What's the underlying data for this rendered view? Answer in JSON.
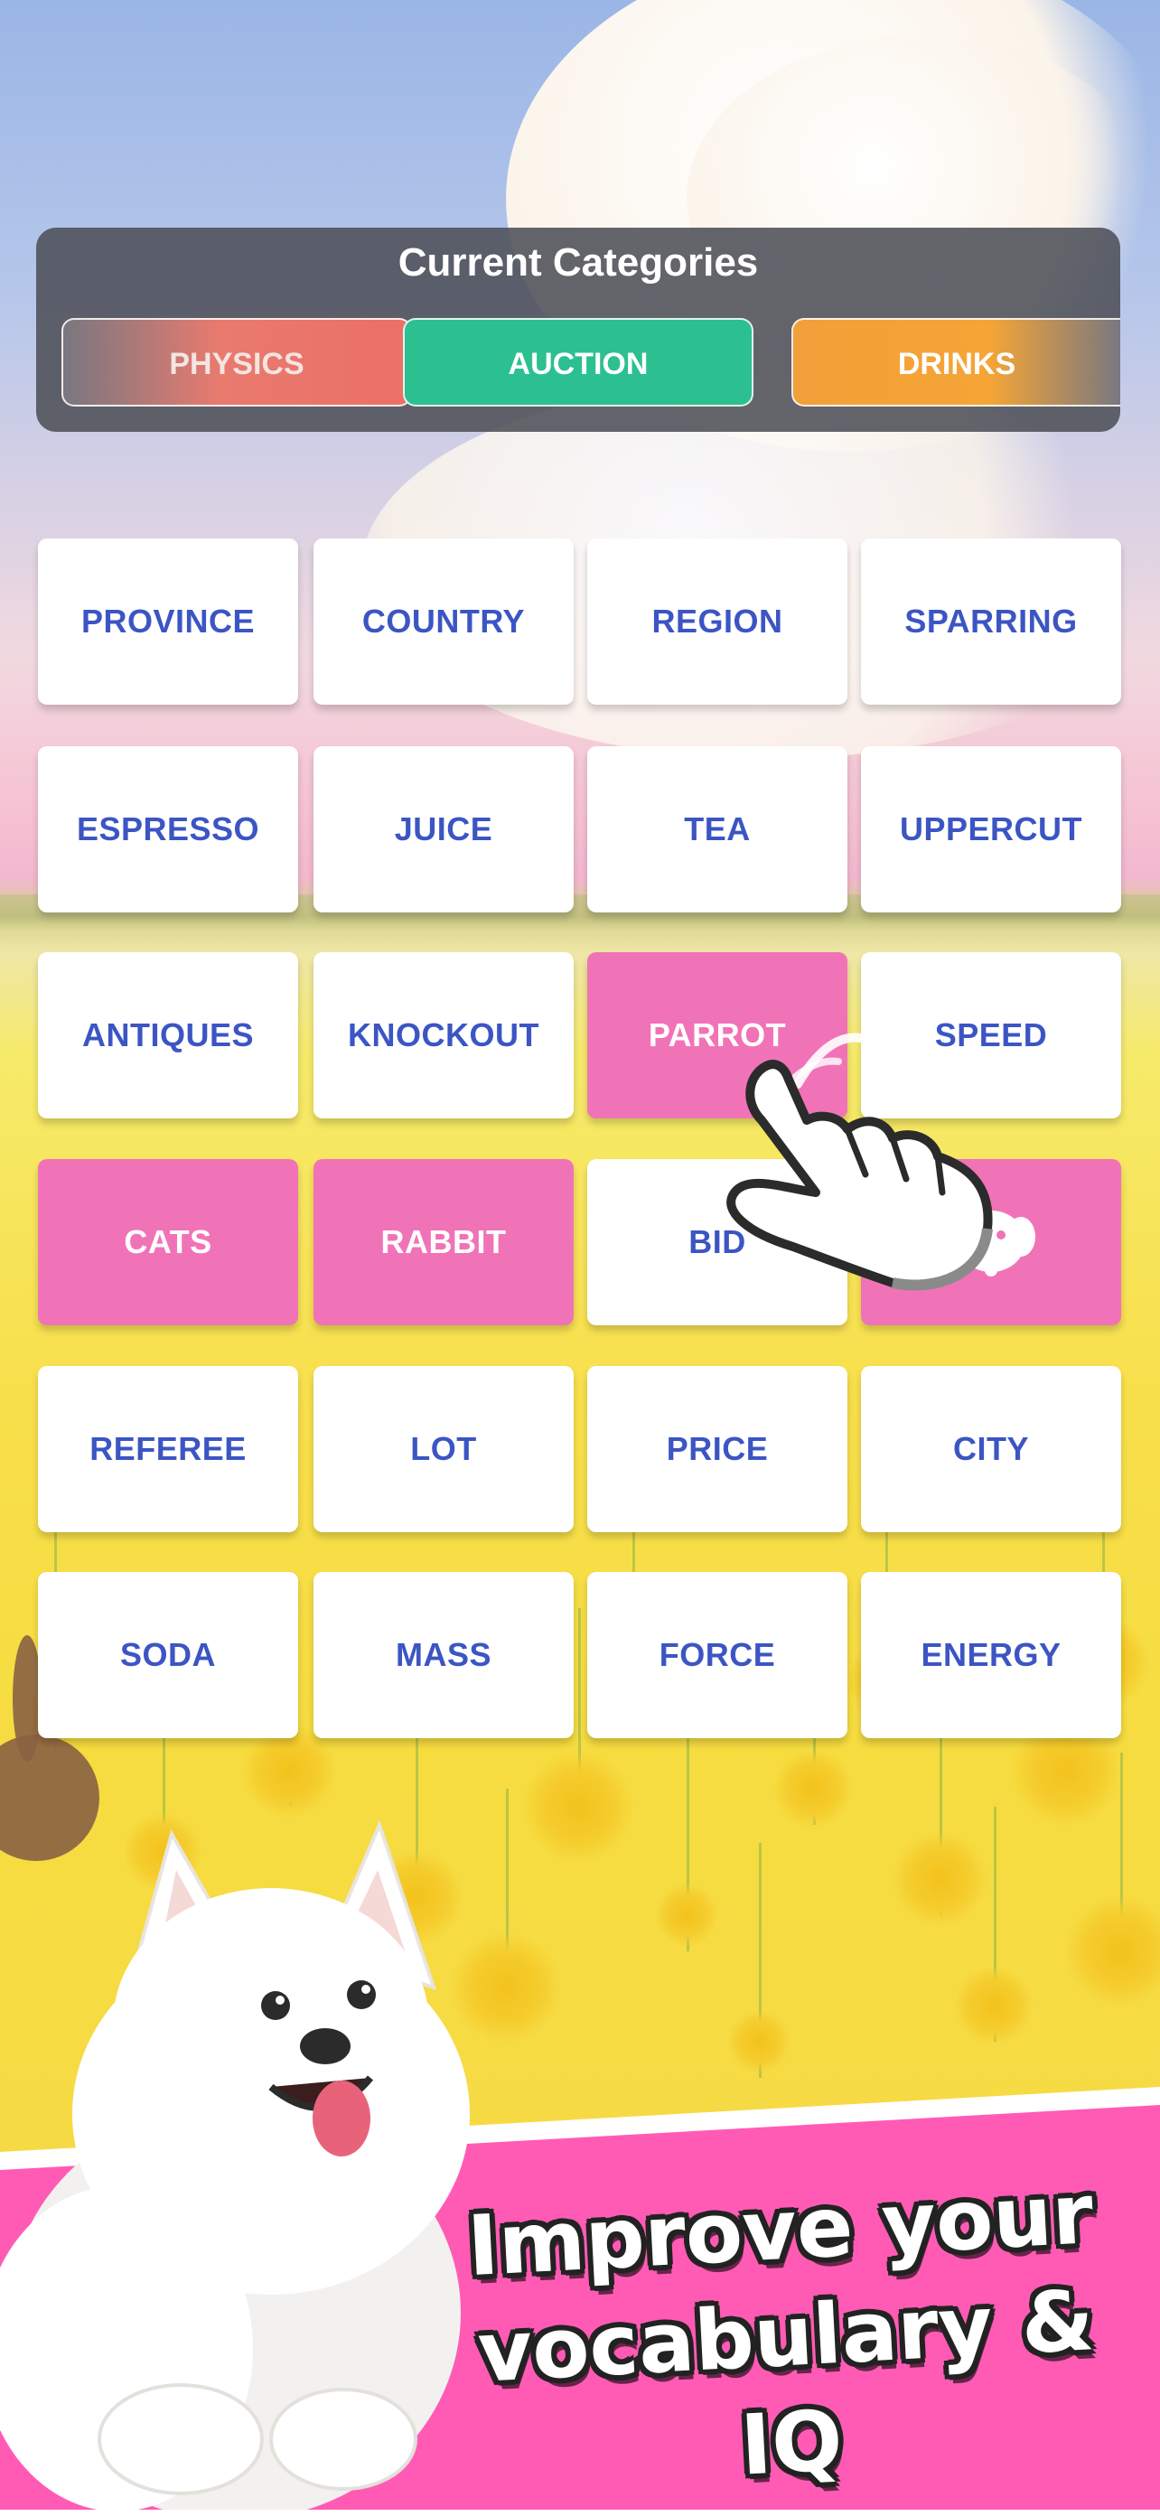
{
  "categories_panel": {
    "title": "Current Categories",
    "items": [
      {
        "label": "PHYSICS",
        "color": "#eb6f67"
      },
      {
        "label": "AUCTION",
        "color": "#2cc090"
      },
      {
        "label": "DRINKS",
        "color": "#f5a535"
      }
    ]
  },
  "grid": {
    "rows": [
      [
        {
          "label": "PROVINCE",
          "selected": false
        },
        {
          "label": "COUNTRY",
          "selected": false
        },
        {
          "label": "REGION",
          "selected": false
        },
        {
          "label": "SPARRING",
          "selected": false
        }
      ],
      [
        {
          "label": "ESPRESSO",
          "selected": false
        },
        {
          "label": "JUICE",
          "selected": false
        },
        {
          "label": "TEA",
          "selected": false
        },
        {
          "label": "UPPERCUT",
          "selected": false
        }
      ],
      [
        {
          "label": "ANTIQUES",
          "selected": false
        },
        {
          "label": "KNOCKOUT",
          "selected": false
        },
        {
          "label": "PARROT",
          "selected": true
        },
        {
          "label": "SPEED",
          "selected": false
        }
      ],
      [
        {
          "label": "CATS",
          "selected": true
        },
        {
          "label": "RABBIT",
          "selected": true
        },
        {
          "label": "BID",
          "selected": false
        },
        {
          "label": "",
          "selected": true
        }
      ],
      [
        {
          "label": "REFEREE",
          "selected": false
        },
        {
          "label": "LOT",
          "selected": false
        },
        {
          "label": "PRICE",
          "selected": false
        },
        {
          "label": "CITY",
          "selected": false
        }
      ],
      [
        {
          "label": "SODA",
          "selected": false
        },
        {
          "label": "MASS",
          "selected": false
        },
        {
          "label": "FORCE",
          "selected": false
        },
        {
          "label": "ENERGY",
          "selected": false
        }
      ]
    ],
    "selected_color": "#f173b7",
    "text_color": "#3c55c4"
  },
  "promo": {
    "line1": "Improve your",
    "line2": "vocabulary & IQ",
    "banner_color": "#ff5bb5"
  },
  "icons": {
    "pointer": "pointing-hand-icon",
    "mascot": "samoyed-dog-illustration",
    "bunny": "bunny-silhouette-illustration",
    "tile_badge": "elephant-icon"
  }
}
